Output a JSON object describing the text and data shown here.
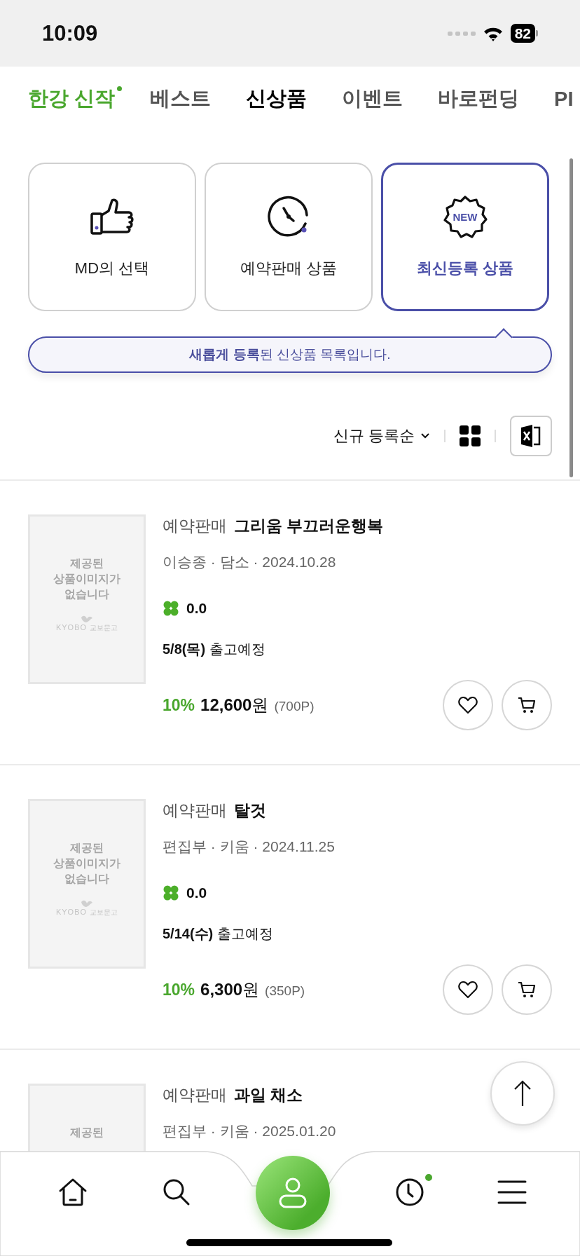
{
  "status_bar": {
    "time": "10:09",
    "battery": "82"
  },
  "tabs": [
    {
      "label": "한강 신작",
      "selected": false,
      "kind": "featured",
      "dot": true
    },
    {
      "label": "베스트",
      "selected": false,
      "kind": "normal",
      "dot": false
    },
    {
      "label": "신상품",
      "selected": true,
      "kind": "normal",
      "dot": false
    },
    {
      "label": "이벤트",
      "selected": false,
      "kind": "normal",
      "dot": false
    },
    {
      "label": "바로펀딩",
      "selected": false,
      "kind": "normal",
      "dot": false
    },
    {
      "label": "PI",
      "selected": false,
      "kind": "normal",
      "dot": false
    }
  ],
  "categories": [
    {
      "label": "MD의 선택",
      "kind": "thumb",
      "selected": false
    },
    {
      "label": "예약판매 상품",
      "kind": "clock",
      "selected": false
    },
    {
      "label": "최신등록 상품",
      "kind": "new",
      "badge_text": "NEW",
      "selected": true
    }
  ],
  "tooltip": "**새롭게 등록**된 신상품 목록입니다.",
  "sort": {
    "label": "신규 등록순"
  },
  "items": [
    {
      "tag": "예약판매",
      "title": "그리움 부끄러운행복",
      "meta": "이승종 · 담소 · 2024.10.28",
      "rating": "0.0",
      "shipping": "**5/8(목)** 출고예정",
      "discount": "10%",
      "price": "**12,600**원",
      "points": "(700P)",
      "no_image": [
        "제공된",
        "상품이미지가",
        "없습니다"
      ],
      "logo": [
        "KYOBO",
        "교보문고"
      ]
    },
    {
      "tag": "예약판매",
      "title": "탈것",
      "meta": "편집부 · 키움 · 2024.11.25",
      "rating": "0.0",
      "shipping": "**5/14(수)** 출고예정",
      "discount": "10%",
      "price": "**6,300**원",
      "points": "(350P)",
      "no_image": [
        "제공된",
        "상품이미지가",
        "없습니다"
      ],
      "logo": [
        "KYOBO",
        "교보문고"
      ]
    },
    {
      "tag": "예약판매",
      "title": "과일 채소",
      "meta": "편집부 · 키움 · 2025.01.20",
      "no_image": [
        "제공된"
      ]
    }
  ],
  "bottom_nav": [
    {
      "kind": "home",
      "dot": false
    },
    {
      "kind": "search",
      "dot": false
    },
    {
      "kind": "profile",
      "dot": false
    },
    {
      "kind": "recent",
      "dot": true
    },
    {
      "kind": "menu",
      "dot": false
    }
  ]
}
